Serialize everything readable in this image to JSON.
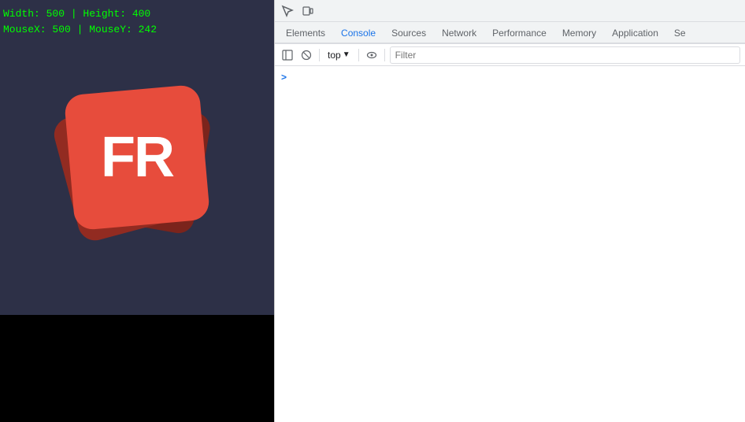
{
  "left_panel": {
    "canvas_info": "Width: 500 | Height: 400\nMouseX: 500 | MouseY: 242",
    "logo_text": "FR"
  },
  "devtools": {
    "topbar_icons": [
      {
        "name": "device-toggle",
        "symbol": "⬜"
      },
      {
        "name": "inspect-element",
        "symbol": "↖"
      }
    ],
    "tabs": [
      {
        "label": "Elements",
        "active": false
      },
      {
        "label": "Console",
        "active": true
      },
      {
        "label": "Sources",
        "active": false
      },
      {
        "label": "Network",
        "active": false
      },
      {
        "label": "Performance",
        "active": false
      },
      {
        "label": "Memory",
        "active": false
      },
      {
        "label": "Application",
        "active": false
      },
      {
        "label": "Se",
        "active": false
      }
    ],
    "toolbar": {
      "clear_button": "🚫",
      "context_label": "top",
      "eye_label": "👁",
      "filter_placeholder": "Filter"
    },
    "console": {
      "prompt_symbol": ">"
    }
  }
}
